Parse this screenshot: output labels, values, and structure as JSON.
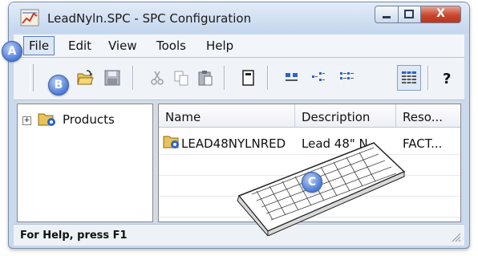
{
  "window": {
    "title": "LeadNyln.SPC - SPC Configuration",
    "close_glyph": "X"
  },
  "menu": {
    "items": [
      "File",
      "Edit",
      "View",
      "Tools",
      "Help"
    ]
  },
  "toolbar": {
    "icons": [
      "open-folder-icon",
      "save-icon",
      "cut-icon",
      "copy-icon",
      "paste-icon",
      "properties-icon",
      "large-icons-icon",
      "small-icons-icon",
      "list-icon",
      "details-icon",
      "help-icon"
    ],
    "active_view": "details"
  },
  "tree": {
    "root_expand": "+",
    "root_label": "Products"
  },
  "list": {
    "columns": [
      "Name",
      "Description",
      "Reso..."
    ],
    "rows": [
      {
        "name": "LEAD48NYLNRED",
        "description": "Lead 48\" N",
        "resource": "FACT..."
      }
    ]
  },
  "status": {
    "text": "For Help, press F1"
  },
  "callouts": {
    "a": "A",
    "b": "B",
    "c": "C"
  },
  "colors": {
    "title_bar": "#c4d6ee",
    "close_button": "#c9472f",
    "callout": "#4d7ad6"
  }
}
